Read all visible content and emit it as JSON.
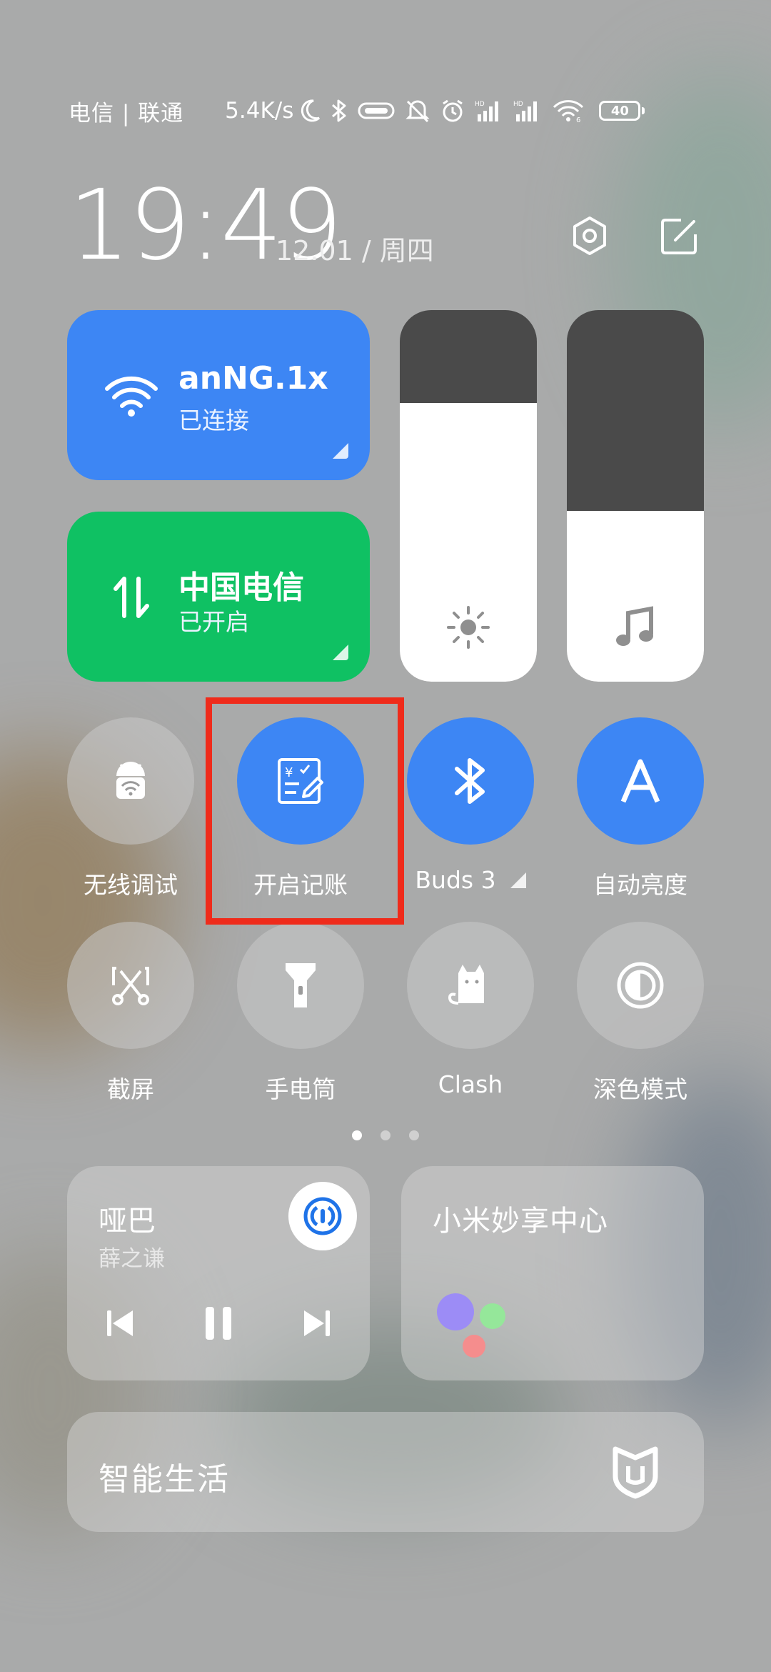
{
  "status_bar": {
    "carrier": "电信 | 联通",
    "net_speed": "5.4K/s",
    "battery_level": "40",
    "icons": [
      "moon-icon",
      "bluetooth-icon",
      "vpn-key-icon",
      "mute-icon",
      "alarm-icon",
      "signal-hd-icon",
      "signal-hd-icon",
      "wifi-6-icon",
      "battery-icon"
    ]
  },
  "header": {
    "time": "19:49",
    "date": "12.01 / 周四"
  },
  "wifi_tile": {
    "title": "anNG.1x",
    "status": "已连接",
    "color": "#3d86f4"
  },
  "mobile_tile": {
    "title": "中国电信",
    "status": "已开启",
    "color": "#0fc163"
  },
  "sliders": {
    "brightness_level": 0.75,
    "volume_level": 0.46
  },
  "toggles_row1": [
    {
      "label": "无线调试",
      "on": false,
      "icon": "android-wifi-icon"
    },
    {
      "label": "开启记账",
      "on": true,
      "icon": "bookkeeping-icon"
    },
    {
      "label": "Buds 3",
      "on": true,
      "icon": "bluetooth-icon"
    },
    {
      "label": "自动亮度",
      "on": true,
      "icon": "auto-brightness-icon"
    }
  ],
  "toggles_row2": [
    {
      "label": "截屏",
      "on": false,
      "icon": "screenshot-icon"
    },
    {
      "label": "手电筒",
      "on": false,
      "icon": "flashlight-icon"
    },
    {
      "label": "Clash",
      "on": false,
      "icon": "cat-icon"
    },
    {
      "label": "深色模式",
      "on": false,
      "icon": "dark-mode-icon"
    }
  ],
  "pager": {
    "pages": 3,
    "active": 1
  },
  "media": {
    "title": "哑巴",
    "artist": "薛之谦"
  },
  "share_card": {
    "title": "小米妙享中心"
  },
  "smart_life": {
    "title": "智能生活"
  },
  "highlight_color": "#ef2b1b"
}
